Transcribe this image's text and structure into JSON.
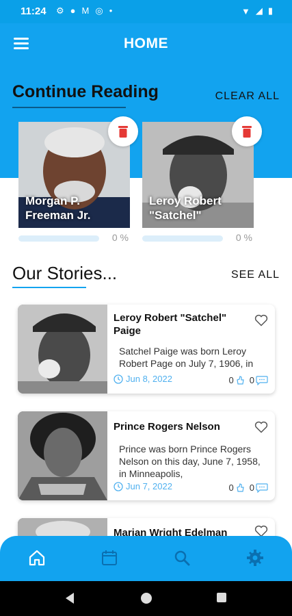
{
  "status_bar": {
    "time": "11:24"
  },
  "header": {
    "title": "HOME"
  },
  "continue_reading": {
    "title": "Continue Reading",
    "clear_all": "CLEAR ALL",
    "items": [
      {
        "name": "Morgan P.\nFreeman Jr.",
        "progress_text": "0 %",
        "progress": 0
      },
      {
        "name": "Leroy Robert\n\"Satchel\"",
        "progress_text": "0 %",
        "progress": 0
      }
    ]
  },
  "stories": {
    "title": "Our Stories...",
    "see_all": "SEE ALL",
    "items": [
      {
        "name": "Leroy Robert \"Satchel\"\nPaige",
        "excerpt": "Satchel Paige was born Leroy Robert Page on July 7, 1906, in",
        "date": "Jun 8, 2022",
        "likes": "0",
        "comments": "0"
      },
      {
        "name": "Prince Rogers Nelson",
        "excerpt": "Prince was born Prince Rogers Nelson on this day, June 7, 1958, in Minneapolis,",
        "date": "Jun 7, 2022",
        "likes": "0",
        "comments": "0"
      },
      {
        "name": "Marian Wright Edelman"
      }
    ]
  },
  "colors": {
    "primary": "#12a3ef",
    "delete": "#e53935",
    "date": "#4fb0ef"
  }
}
